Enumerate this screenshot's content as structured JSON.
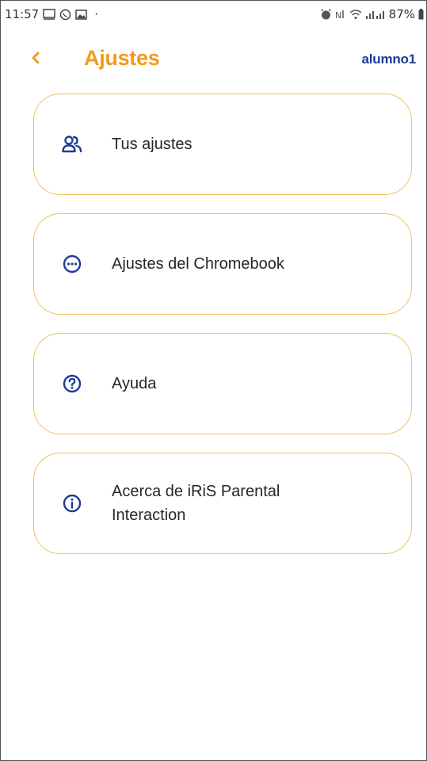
{
  "status_bar": {
    "time": "11:57",
    "dot": "·",
    "battery": "87%",
    "left_icons": [
      "cast-icon",
      "whatsapp-icon",
      "image-icon"
    ],
    "right_icons": [
      "alarm-icon",
      "signal-icon",
      "wifi-icon",
      "cell-signal-icon",
      "battery-icon"
    ]
  },
  "header": {
    "back_icon": "chevron-left-icon",
    "title": "Ajustes",
    "username": "alumno1"
  },
  "menu": {
    "items": [
      {
        "label": "Tus ajustes",
        "icon": "users-icon"
      },
      {
        "label": "Ajustes del Chromebook",
        "icon": "more-circle-icon"
      },
      {
        "label": "Ayuda",
        "icon": "help-circle-icon"
      },
      {
        "label": "Acerca de iRiS Parental\nInteraction",
        "icon": "info-circle-icon"
      }
    ]
  },
  "colors": {
    "accent": "#f29a1c",
    "card_border": "#f2c05e",
    "icon_blue": "#1f3b95",
    "username_blue": "#1f3b95"
  }
}
